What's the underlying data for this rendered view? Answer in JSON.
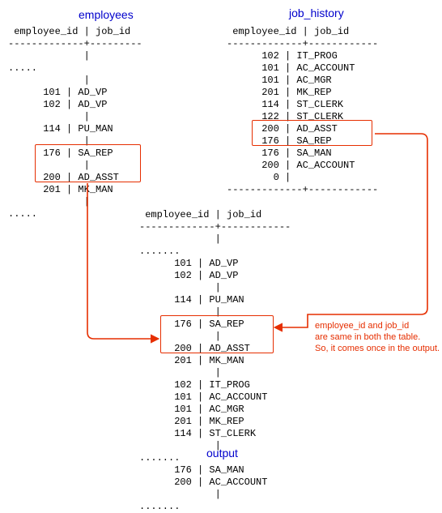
{
  "tables": {
    "employees": {
      "title": "employees",
      "columns": {
        "c1": "employee_id",
        "c2": "job_id"
      },
      "dash": "-------------+---------",
      "bar": "             |",
      "dots": ".....",
      "rows": {
        "r0": "      101 | AD_VP",
        "r1": "      102 | AD_VP",
        "r2": "      114 | PU_MAN",
        "r3": "      176 | SA_REP",
        "r4": "      200 | AD_ASST",
        "r5": "      201 | MK_MAN"
      }
    },
    "job_history": {
      "title": "job_history",
      "columns": {
        "c1": "employee_id",
        "c2": "job_id"
      },
      "dash": "-------------+------------",
      "bar": "             |",
      "rows": {
        "r0": "      102 | IT_PROG",
        "r1": "      101 | AC_ACCOUNT",
        "r2": "      101 | AC_MGR",
        "r3": "      201 | MK_REP",
        "r4": "      114 | ST_CLERK",
        "r5": "      122 | ST_CLERK",
        "r6": "      200 | AD_ASST",
        "r7": "      176 | SA_REP",
        "r8": "      176 | SA_MAN",
        "r9": "      200 | AC_ACCOUNT",
        "r10": "        0 |"
      }
    },
    "output": {
      "title": "output",
      "columns": {
        "c1": "employee_id",
        "c2": "job_id"
      },
      "dash": "-------------+------------",
      "bar": "             |",
      "dots": ".......",
      "rows": {
        "r0": "      101 | AD_VP",
        "r1": "      102 | AD_VP",
        "r2": "      114 | PU_MAN",
        "r3": "      176 | SA_REP",
        "r4": "      200 | AD_ASST",
        "r5": "      201 | MK_MAN",
        "r6": "      102 | IT_PROG",
        "r7": "      101 | AC_ACCOUNT",
        "r8": "      101 | AC_MGR",
        "r9": "      201 | MK_REP",
        "r10": "      114 | ST_CLERK",
        "r11": "      176 | SA_MAN",
        "r12": "      200 | AC_ACCOUNT"
      }
    }
  },
  "annotation": {
    "line1": "employee_id and job_id",
    "line2": "are same in both the table.",
    "line3": "So, it comes once in the output."
  },
  "colors": {
    "header": "#0000CC",
    "highlight": "#E62E00"
  }
}
